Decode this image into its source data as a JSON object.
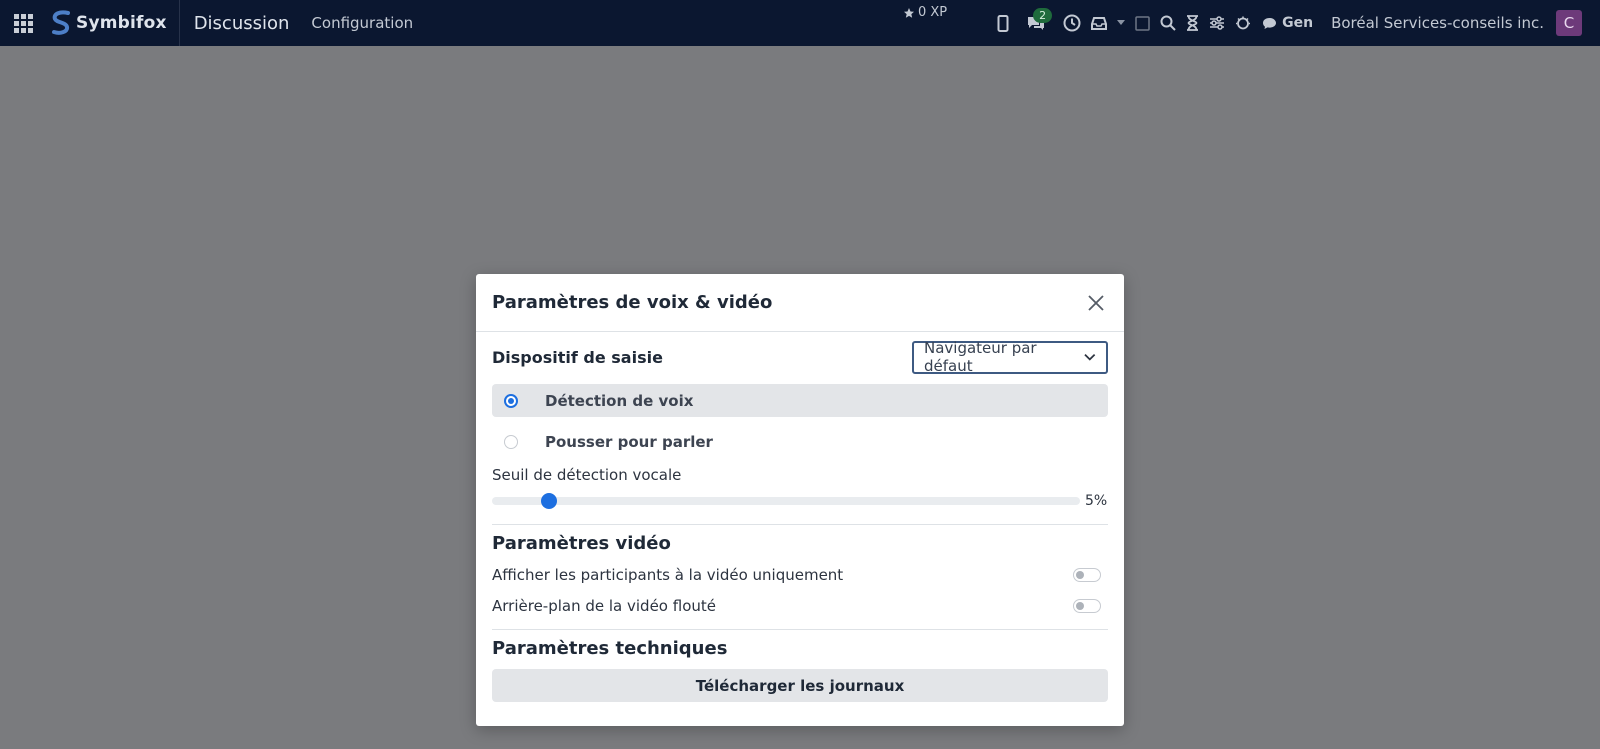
{
  "navbar": {
    "brand": "Symbifox",
    "app_title": "Discussion",
    "menu_item": "Configuration",
    "xp_label": "0 XP",
    "chat_badge": "2",
    "gen_label": "Gen",
    "company": "Boréal Services-conseils inc.",
    "avatar_letter": "C"
  },
  "modal": {
    "title": "Paramètres de voix & vidéo",
    "input_device_label": "Dispositif de saisie",
    "input_device_value": "Navigateur par défaut",
    "options": [
      {
        "label": "Détection de voix",
        "selected": true
      },
      {
        "label": "Pousser pour parler",
        "selected": false
      }
    ],
    "threshold_label": "Seuil de détection vocale",
    "threshold_value": "5%",
    "threshold_fraction": 0.05,
    "video_section": "Paramètres vidéo",
    "video_options": [
      {
        "label": "Afficher les participants à la vidéo uniquement",
        "on": false
      },
      {
        "label": "Arrière-plan de la vidéo flouté",
        "on": false
      }
    ],
    "tech_section": "Paramètres techniques",
    "download_button": "Télécharger les journaux"
  },
  "colors": {
    "navbar_bg": "#0b1730",
    "overlay": "#7a7b7e",
    "accent": "#1d6fe0",
    "badge_bg": "#1f6b3c",
    "avatar_bg": "#6d3a7a"
  }
}
